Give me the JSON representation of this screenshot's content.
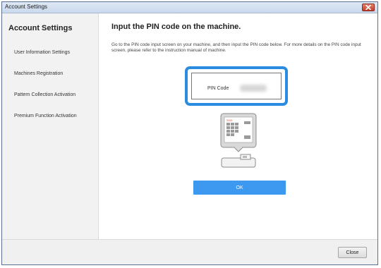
{
  "window": {
    "title": "Account Settings"
  },
  "sidebar": {
    "heading": "Account Settings",
    "items": [
      {
        "label": "User Information Settings"
      },
      {
        "label": "Machines Registration"
      },
      {
        "label": "Pattern Collection Activation"
      },
      {
        "label": "Premium Function Activation"
      }
    ]
  },
  "main": {
    "heading": "Input the PIN code on the machine.",
    "description": "Go to the PIN code input screen on your machine, and then input the PIN code below. For more details on the PIN code input screen, please refer to the instruction manual of machine.",
    "pin_label": "PIN Code",
    "ok_label": "OK",
    "illustration": {
      "screen_text": "XXXX",
      "icon": "machine-icon"
    }
  },
  "footer": {
    "close_label": "Close"
  },
  "colors": {
    "accent": "#3d98f0",
    "highlight_border": "#2a8be0",
    "close_red": "#c33e2a",
    "sidebar_bg": "#f2f2f2"
  }
}
